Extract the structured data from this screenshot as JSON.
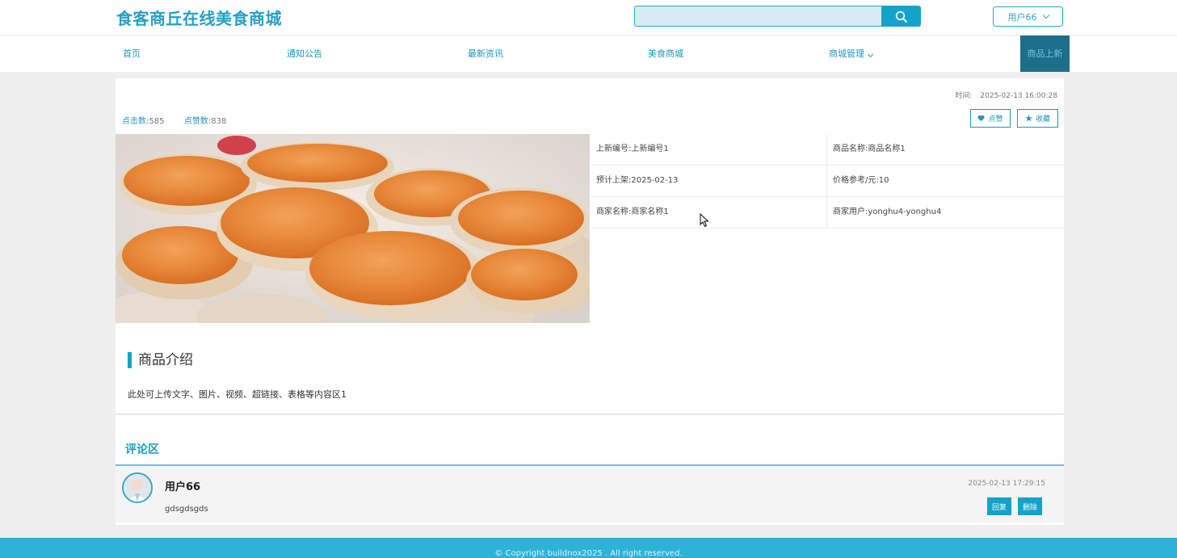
{
  "header": {
    "logo": "食客商丘在线美食商城",
    "search_placeholder": "",
    "user_label": "用户66"
  },
  "nav": {
    "items": [
      {
        "label": "首页"
      },
      {
        "label": "通知公告"
      },
      {
        "label": "最新资讯"
      },
      {
        "label": "美食商城"
      },
      {
        "label": "商城管理"
      }
    ],
    "active": "商品上新"
  },
  "detail": {
    "time_label": "时间:",
    "time_value": "2025-02-13 16:00:28",
    "clicks_label": "点击数:",
    "clicks_value": "585",
    "likes_label": "点赞数:",
    "likes_value": "838",
    "like_button": "点赞",
    "fav_button": "收藏",
    "fields": [
      [
        "上新编号:上新编号1",
        "商品名称:商品名称1"
      ],
      [
        "预计上架:2025-02-13",
        "价格参考/元:10"
      ],
      [
        "商家名称:商家名称1",
        "商家用户:yonghu4-yonghu4"
      ]
    ],
    "intro_title": "商品介绍",
    "intro_text": "此处可上传文字、图片、视频、超链接、表格等内容区1"
  },
  "comments": {
    "title": "评论区",
    "items": [
      {
        "user": "用户66",
        "text": "gdsgdsgds",
        "time": "2025-02-13 17:29:15",
        "reply": "回复",
        "delete": "删除"
      }
    ]
  },
  "footer": {
    "copyright": "© Copyright buildnox2025 . All right reserved."
  },
  "colors": {
    "brand": "#27a0c4",
    "accent": "#13a3ca",
    "nav_active_bg": "#1b6f8a",
    "footer_bg": "#2db3d8"
  }
}
